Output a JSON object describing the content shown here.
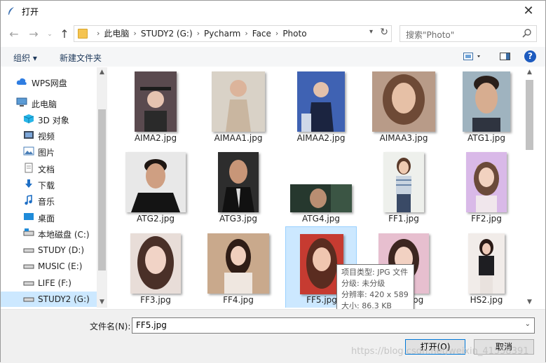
{
  "window": {
    "title": "打开"
  },
  "address": {
    "crumbs": [
      "此电脑",
      "STUDY2 (G:)",
      "Pycharm",
      "Face",
      "Photo"
    ]
  },
  "search": {
    "placeholder": "搜索\"Photo\""
  },
  "toolbar": {
    "organize": "组织 ▾",
    "new_folder": "新建文件夹"
  },
  "sidebar": {
    "items": [
      {
        "label": "WPS网盘",
        "icon": "cloud-icon"
      },
      {
        "label": "此电脑",
        "icon": "computer-icon"
      },
      {
        "label": "3D 对象",
        "icon": "cube-icon"
      },
      {
        "label": "视频",
        "icon": "video-icon"
      },
      {
        "label": "图片",
        "icon": "picture-icon"
      },
      {
        "label": "文档",
        "icon": "document-icon"
      },
      {
        "label": "下载",
        "icon": "download-icon"
      },
      {
        "label": "音乐",
        "icon": "music-icon"
      },
      {
        "label": "桌面",
        "icon": "desktop-icon"
      },
      {
        "label": "本地磁盘 (C:)",
        "icon": "drive-icon"
      },
      {
        "label": "STUDY (D:)",
        "icon": "drive-icon"
      },
      {
        "label": "MUSIC (E:)",
        "icon": "drive-icon"
      },
      {
        "label": "LIFE (F:)",
        "icon": "drive-icon"
      },
      {
        "label": "STUDY2 (G:)",
        "icon": "drive-icon"
      }
    ]
  },
  "files": [
    {
      "name": "AIMA2.jpg"
    },
    {
      "name": "AIMAA1.jpg"
    },
    {
      "name": "AIMAA2.jpg"
    },
    {
      "name": "AIMAA3.jpg"
    },
    {
      "name": "ATG1.jpg"
    },
    {
      "name": "ATG2.jpg"
    },
    {
      "name": "ATG3.jpg"
    },
    {
      "name": "ATG4.jpg"
    },
    {
      "name": "FF1.jpg"
    },
    {
      "name": "FF2.jpg"
    },
    {
      "name": "FF3.jpg"
    },
    {
      "name": "FF4.jpg"
    },
    {
      "name": "FF5.jpg"
    },
    {
      "name": "jpg"
    },
    {
      "name": "HS2.jpg"
    }
  ],
  "tooltip": {
    "type": "项目类型: JPG 文件",
    "rating": "分级: 未分级",
    "resolution": "分辨率: 420 x 589",
    "size": "大小: 86.3 KB"
  },
  "bottom": {
    "filename_label": "文件名(N):",
    "filename_value": "FF5.jpg",
    "open_label": "打开(O)",
    "cancel_label": "取消"
  },
  "watermark": "https://blog.csdn.net/weixin_41558391",
  "colors": {
    "selection": "#cce8ff",
    "selection_border": "#99d1ff",
    "help": "#1d5bbf",
    "folder": "#f5c451"
  }
}
